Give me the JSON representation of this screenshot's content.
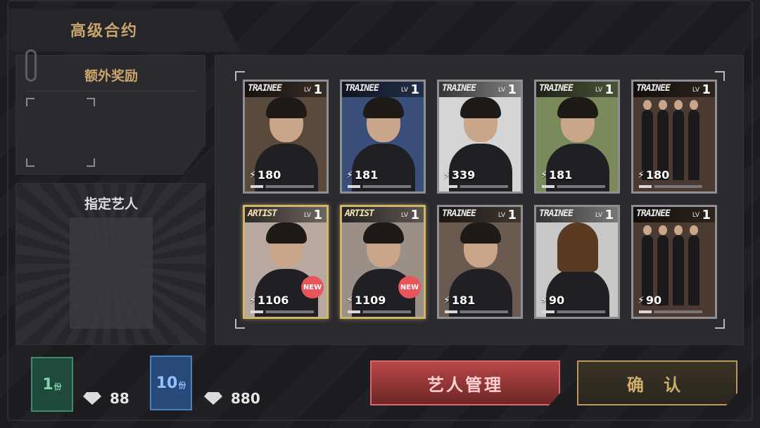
{
  "header": {
    "title": "高级合约"
  },
  "bonus": {
    "title": "额外奖励"
  },
  "designated": {
    "title": "指定艺人"
  },
  "cards": [
    {
      "tier": "TRAINEE",
      "lv_label": "LV",
      "level": "1",
      "stat": "180",
      "gold": false,
      "is_new": false,
      "bg": "#5a4a3c",
      "type": "male"
    },
    {
      "tier": "TRAINEE",
      "lv_label": "LV",
      "level": "1",
      "stat": "181",
      "gold": false,
      "is_new": false,
      "bg": "#3a4e7a",
      "type": "male"
    },
    {
      "tier": "TRAINEE",
      "lv_label": "LV",
      "level": "1",
      "stat": "339",
      "gold": false,
      "is_new": false,
      "bg": "#d5d5d5",
      "type": "male"
    },
    {
      "tier": "TRAINEE",
      "lv_label": "LV",
      "level": "1",
      "stat": "181",
      "gold": false,
      "is_new": false,
      "bg": "#7a8a5a",
      "type": "male"
    },
    {
      "tier": "TRAINEE",
      "lv_label": "LV",
      "level": "1",
      "stat": "180",
      "gold": false,
      "is_new": false,
      "bg": "#4a3a32",
      "type": "group"
    },
    {
      "tier": "ARTIST",
      "lv_label": "LV",
      "level": "1",
      "stat": "1106",
      "gold": true,
      "is_new": true,
      "new_label": "NEW",
      "bg": "#b8a8a0",
      "type": "male"
    },
    {
      "tier": "ARTIST",
      "lv_label": "LV",
      "level": "1",
      "stat": "1109",
      "gold": true,
      "is_new": true,
      "new_label": "NEW",
      "bg": "#9a9088",
      "type": "male"
    },
    {
      "tier": "TRAINEE",
      "lv_label": "LV",
      "level": "1",
      "stat": "181",
      "gold": false,
      "is_new": false,
      "bg": "#6a5a50",
      "type": "male"
    },
    {
      "tier": "TRAINEE",
      "lv_label": "LV",
      "level": "1",
      "stat": "90",
      "gold": false,
      "is_new": false,
      "bg": "#c8c8c8",
      "type": "female"
    },
    {
      "tier": "TRAINEE",
      "lv_label": "LV",
      "level": "1",
      "stat": "90",
      "gold": false,
      "is_new": false,
      "bg": "#4a3a32",
      "type": "group"
    }
  ],
  "purchase": {
    "single": {
      "label": "1",
      "unit": "份",
      "price": "88"
    },
    "ten": {
      "label": "10",
      "unit": "份",
      "price": "880"
    }
  },
  "buttons": {
    "manage": "艺人管理",
    "confirm": "确 认"
  },
  "colors": {
    "gold": "#c9a56a",
    "manage_red": "#b84747",
    "pack_green": "#1f4a3b",
    "pack_blue": "#284a78"
  }
}
